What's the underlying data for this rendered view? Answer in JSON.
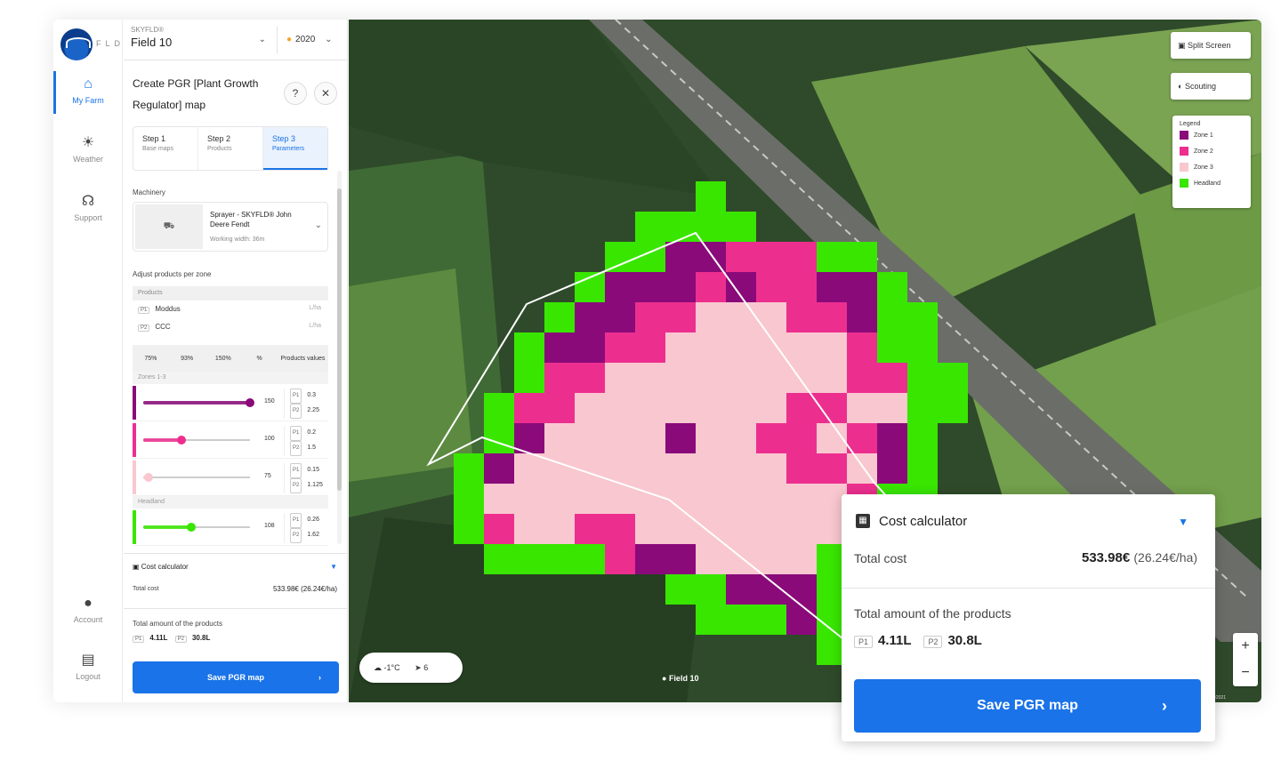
{
  "app": {
    "logo_text": "FLD"
  },
  "nav": {
    "items": [
      {
        "label": "My Farm",
        "icon": "home-icon"
      },
      {
        "label": "Weather",
        "icon": "sun-icon"
      },
      {
        "label": "Support",
        "icon": "headset-icon"
      }
    ],
    "bottom_items": [
      {
        "label": "Account",
        "icon": "user-icon"
      },
      {
        "label": "Logout",
        "icon": "logout-icon"
      }
    ]
  },
  "header": {
    "farm_label": "SKYFLD®",
    "field_name": "Field 10",
    "season": "2020"
  },
  "panel": {
    "title": "Create PGR [Plant Growth Regulator] map",
    "steps": [
      {
        "label": "Step 1",
        "sub": "Base maps"
      },
      {
        "label": "Step 2",
        "sub": "Products"
      },
      {
        "label": "Step 3",
        "sub": "Parameters"
      }
    ],
    "machinery_label": "Machinery",
    "machine": {
      "name": "Sprayer - SKYFLD® John Deere Fendt",
      "width": "Working width: 36m"
    },
    "adjust_label": "Adjust products per zone",
    "products_header": "Products",
    "products": [
      {
        "tag": "P1",
        "name": "Moddus",
        "unit": "L/ha"
      },
      {
        "tag": "P2",
        "name": "CCC",
        "unit": "L/ha"
      }
    ],
    "zone_columns": [
      "75%",
      "93%",
      "150%",
      "%",
      "Products values"
    ],
    "zones_label": "Zones 1-3",
    "zones": [
      {
        "pct": "150",
        "p1": "0.3",
        "p2": "2.25",
        "color": "#8a0a7a",
        "level": 1.0
      },
      {
        "pct": "100",
        "p1": "0.2",
        "p2": "1.5",
        "color": "#ec2f8f",
        "level": 0.36
      },
      {
        "pct": "75",
        "p1": "0.15",
        "p2": "1.125",
        "color": "#f9c7cf",
        "level": 0.05
      }
    ],
    "headland_label": "Headland",
    "headland": {
      "pct": "108",
      "p1": "0.26",
      "p2": "1.62",
      "color": "#39e600",
      "level": 0.45
    },
    "cost_title": "Cost calculator",
    "total_cost_label": "Total cost",
    "total_cost_value": "533.98€ (26.24€/ha)",
    "amount_label": "Total amount of the products",
    "amount_p1": "4.11L",
    "amount_p2": "30.8L",
    "save_label": "Save PGR map"
  },
  "map": {
    "split_screen": "Split Screen",
    "scouting": "Scouting",
    "legend_title": "Legend",
    "legend": [
      {
        "label": "Zone 1",
        "color": "#8a0a7a"
      },
      {
        "label": "Zone 2",
        "color": "#ec2f8f"
      },
      {
        "label": "Zone 3",
        "color": "#f9c7cf"
      },
      {
        "label": "Headland",
        "color": "#39e600"
      }
    ],
    "weather_temp": "-1°C",
    "wind": "6",
    "field_tag": "Field 10",
    "attribution": "Map data ©2021 Imagery ©2021"
  },
  "cost_card": {
    "title": "Cost calculator",
    "total_cost_label": "Total cost",
    "total_cost": "533.98€",
    "per_ha": "(26.24€/ha)",
    "amount_label": "Total amount of the products",
    "p1_tag": "P1",
    "p1_value": "4.11L",
    "p2_tag": "P2",
    "p2_value": "30.8L",
    "save_label": "Save PGR map"
  }
}
